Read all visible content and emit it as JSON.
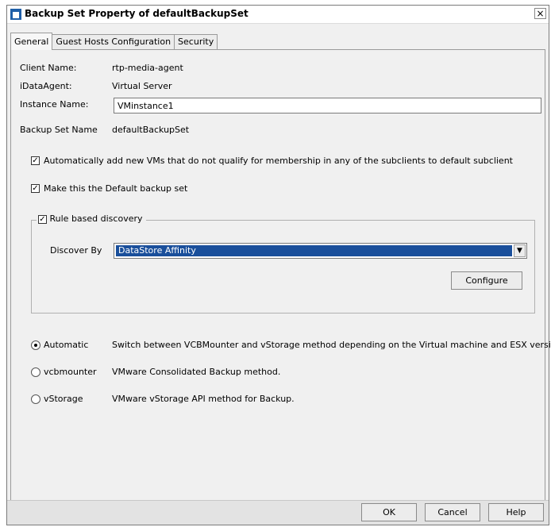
{
  "window": {
    "title": "Backup Set Property of defaultBackupSet",
    "close_glyph": "×"
  },
  "tabs": [
    {
      "label": "General",
      "active": true
    },
    {
      "label": "Guest Hosts Configuration",
      "active": false
    },
    {
      "label": "Security",
      "active": false
    }
  ],
  "general": {
    "client_name_label": "Client Name:",
    "client_name_value": "rtp-media-agent",
    "idataagent_label": "iDataAgent:",
    "idataagent_value": "Virtual Server",
    "instance_name_label": "Instance Name:",
    "instance_name_value": "VMinstance1",
    "backup_set_name_label": "Backup Set Name",
    "backup_set_name_value": "defaultBackupSet",
    "auto_add_label": "Automatically add new VMs that do not qualify for membership in any of the subclients to default subclient",
    "auto_add_checked": true,
    "default_set_label": "Make this the Default backup set",
    "default_set_checked": true
  },
  "rule_discovery": {
    "label": "Rule based discovery",
    "checked": true,
    "discover_by_label": "Discover By",
    "discover_by_value": "DataStore Affinity",
    "configure_label": "Configure"
  },
  "methods": [
    {
      "label": "Automatic",
      "description": "Switch between VCBMounter and vStorage method depending on the Virtual machine and ESX version.",
      "selected": true
    },
    {
      "label": "vcbmounter",
      "description": "VMware Consolidated Backup method.",
      "selected": false
    },
    {
      "label": "vStorage",
      "description": "VMware vStorage API method for Backup.",
      "selected": false
    }
  ],
  "buttons": {
    "ok": "OK",
    "cancel": "Cancel",
    "help": "Help"
  },
  "icons": {
    "app": "backup-app-icon",
    "close": "close-icon",
    "dropdown": "chevron-down-icon",
    "check": "checkmark-icon"
  },
  "check_glyph": "✓",
  "dropdown_glyph": "▼"
}
